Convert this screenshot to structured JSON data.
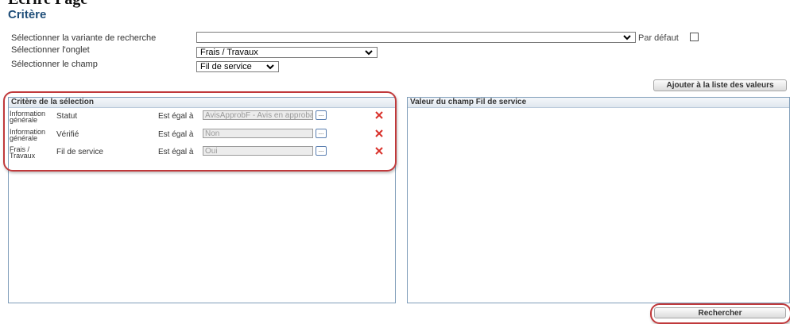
{
  "page": {
    "clipped_title": "Ecrire Page",
    "section_title": "Critère"
  },
  "form": {
    "variant_label": "Sélectionner la variante de recherche",
    "variant_value": "",
    "default_label": "Par défaut",
    "default_checked": false,
    "tab_label": "Sélectionner l'onglet",
    "tab_value": "Frais / Travaux",
    "field_label": "Sélectionner le champ",
    "field_value": "Fil de service"
  },
  "buttons": {
    "add_to_list": "Ajouter à la liste des valeurs",
    "search": "Rechercher"
  },
  "criteria_panel": {
    "title": "Critère de la sélection",
    "rows": [
      {
        "category": "Information générale",
        "field": "Statut",
        "operator": "Est égal à",
        "value": "AvisApprobF - Avis en approbation",
        "more": "..."
      },
      {
        "category": "Information générale",
        "field": "Vérifié",
        "operator": "Est égal à",
        "value": "Non",
        "more": "..."
      },
      {
        "category": "Frais / Travaux",
        "field": "Fil de service",
        "operator": "Est égal à",
        "value": "Oui",
        "more": "..."
      }
    ]
  },
  "value_panel": {
    "title": "Valeur du champ Fil de service"
  },
  "colors": {
    "section_title": "#1f4e79",
    "highlight": "#c0393b",
    "delete": "#d9312b",
    "panel_border": "#7f9db9"
  },
  "icons": {
    "delete": "close-x-icon",
    "dropdown": "chevron-down-icon"
  }
}
